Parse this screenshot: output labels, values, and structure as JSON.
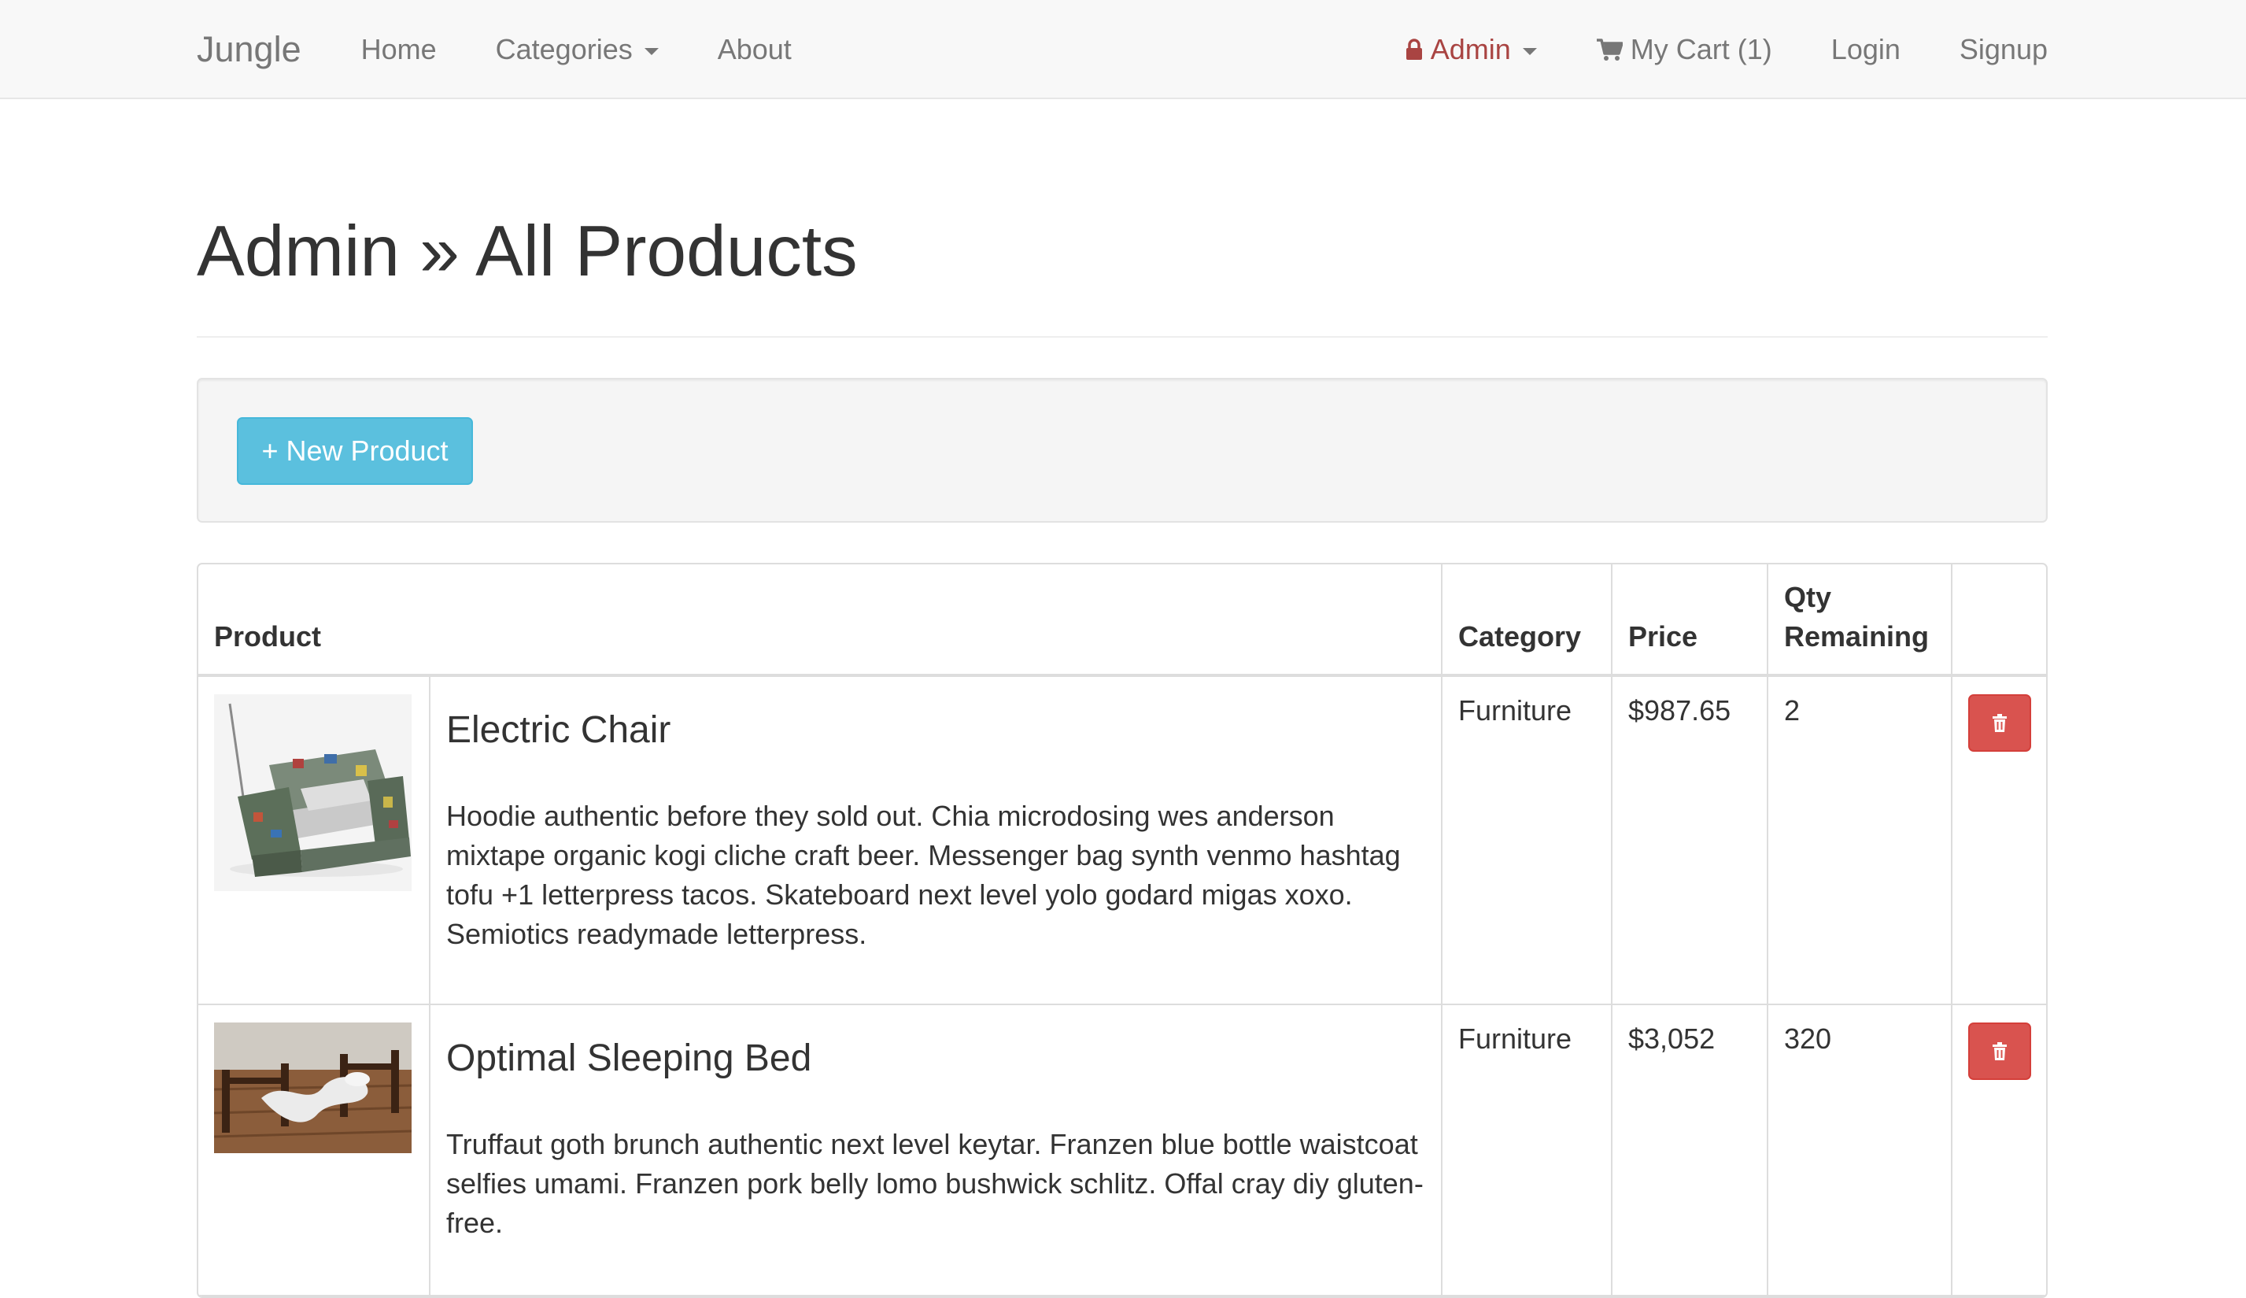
{
  "nav": {
    "brand": "Jungle",
    "links": [
      {
        "label": "Home"
      },
      {
        "label": "Categories"
      },
      {
        "label": "About"
      }
    ],
    "admin_label": "Admin",
    "cart_label": "My Cart (1)",
    "login_label": "Login",
    "signup_label": "Signup"
  },
  "page": {
    "title": "Admin » All Products"
  },
  "toolbar": {
    "new_product_label": "+ New Product"
  },
  "table": {
    "headers": {
      "product": "Product",
      "category": "Category",
      "price": "Price",
      "qty_line1": "Qty",
      "qty_line2": "Remaining"
    },
    "rows": [
      {
        "name": "Electric Chair",
        "description": "Hoodie authentic before they sold out. Chia microdosing wes anderson mixtape organic kogi cliche craft beer. Messenger bag synth venmo hashtag tofu +1 letterpress tacos. Skateboard next level yolo godard migas xoxo. Semiotics readymade letterpress.",
        "category": "Furniture",
        "price": "$987.65",
        "qty": "2"
      },
      {
        "name": "Optimal Sleeping Bed",
        "description": "Truffaut goth brunch authentic next level keytar. Franzen blue bottle waistcoat selfies umami. Franzen pork belly lomo bushwick schlitz. Offal cray diy gluten-free.",
        "category": "Furniture",
        "price": "$3,052",
        "qty": "320"
      }
    ]
  },
  "colors": {
    "navbar_bg": "#f8f8f8",
    "admin_accent": "#a94442",
    "info_button": "#5bc0de",
    "danger_button": "#d9534f"
  },
  "icons": {
    "admin": "lock-icon",
    "cart": "shopping-cart-icon",
    "delete": "trash-icon"
  }
}
